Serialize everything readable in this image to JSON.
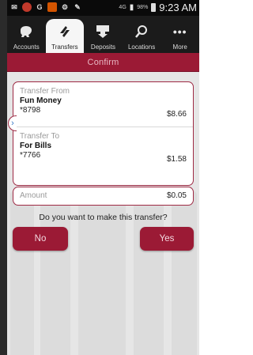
{
  "status_bar": {
    "time": "9:23 AM",
    "battery": "98%",
    "network": "4G"
  },
  "tabs": [
    {
      "label": "Accounts",
      "icon": "piggy-bank-icon"
    },
    {
      "label": "Transfers",
      "icon": "transfer-arrows-icon",
      "active": true
    },
    {
      "label": "Deposits",
      "icon": "deposit-icon"
    },
    {
      "label": "Locations",
      "icon": "search-icon"
    },
    {
      "label": "More",
      "icon": "more-dots-icon"
    }
  ],
  "screen_title": "Confirm",
  "transfer_from": {
    "label": "Transfer From",
    "name": "Fun Money",
    "account": "*8798",
    "balance": "$8.66"
  },
  "transfer_to": {
    "label": "Transfer To",
    "name": "For Bills",
    "account": "*7766",
    "balance": "$1.58"
  },
  "amount": {
    "label": "Amount",
    "value": "$0.05"
  },
  "question": "Do you want to make this transfer?",
  "buttons": {
    "no": "No",
    "yes": "Yes"
  },
  "colors": {
    "accent": "#9b1a35",
    "background": "#e6e6e6"
  }
}
